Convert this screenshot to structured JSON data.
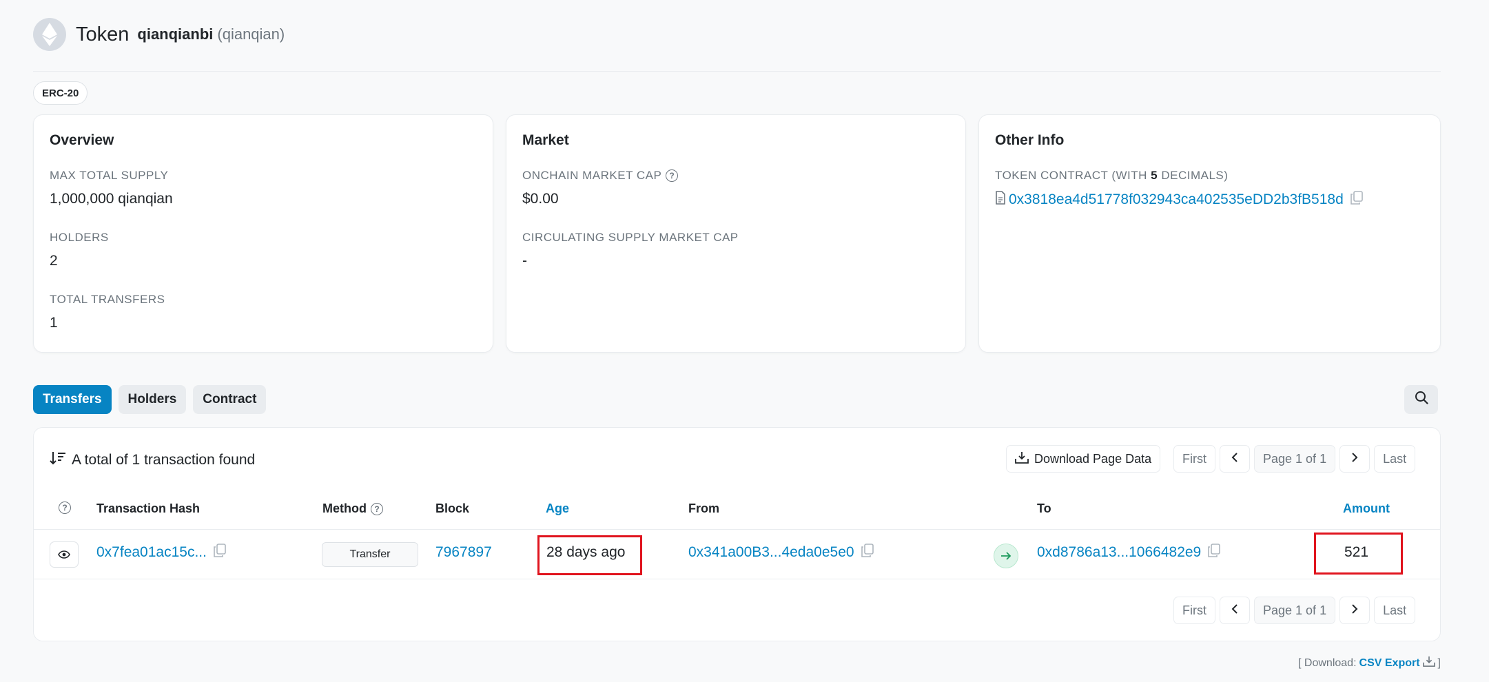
{
  "header": {
    "token_label": "Token",
    "name": "qianqianbi",
    "symbol": "(qianqian)"
  },
  "standard_badge": "ERC-20",
  "overview": {
    "title": "Overview",
    "max_supply_label": "MAX TOTAL SUPPLY",
    "max_supply_value": "1,000,000 qianqian",
    "holders_label": "HOLDERS",
    "holders_value": "2",
    "transfers_label": "TOTAL TRANSFERS",
    "transfers_value": "1"
  },
  "market": {
    "title": "Market",
    "onchain_cap_label": "ONCHAIN MARKET CAP",
    "onchain_cap_value": "$0.00",
    "circ_cap_label": "CIRCULATING SUPPLY MARKET CAP",
    "circ_cap_value": "-"
  },
  "other_info": {
    "title": "Other Info",
    "contract_label_prefix": "TOKEN CONTRACT (WITH ",
    "contract_decimals": "5",
    "contract_label_suffix": " DECIMALS)",
    "contract_address": "0x3818ea4d51778f032943ca402535eDD2b3fB518d"
  },
  "tabs": [
    {
      "label": "Transfers",
      "active": true
    },
    {
      "label": "Holders",
      "active": false
    },
    {
      "label": "Contract",
      "active": false
    }
  ],
  "table": {
    "summary": "A total of 1 transaction found",
    "download_label": "Download Page Data",
    "pager": {
      "first": "First",
      "page_info": "Page 1 of 1",
      "last": "Last"
    },
    "columns": {
      "hash": "Transaction Hash",
      "method": "Method",
      "block": "Block",
      "age": "Age",
      "from": "From",
      "to": "To",
      "amount": "Amount"
    },
    "rows": [
      {
        "hash": "0x7fea01ac15c...",
        "method": "Transfer",
        "block": "7967897",
        "age": "28 days ago",
        "from": "0x341a00B3...4eda0e5e0",
        "to": "0xd8786a13...1066482e9",
        "amount": "521"
      }
    ]
  },
  "footer": {
    "prefix": "[ Download:",
    "link": "CSV Export",
    "suffix": "]"
  },
  "colors": {
    "accent": "#0784c3",
    "highlight": "#e0141e",
    "in_arrow": "#1d9a5c"
  },
  "icons": [
    "ethereum-icon",
    "question-icon",
    "file-icon",
    "copy-icon",
    "search-icon",
    "sort-icon",
    "download-icon",
    "chevron-left-icon",
    "chevron-right-icon",
    "eye-icon",
    "arrow-right-icon"
  ]
}
